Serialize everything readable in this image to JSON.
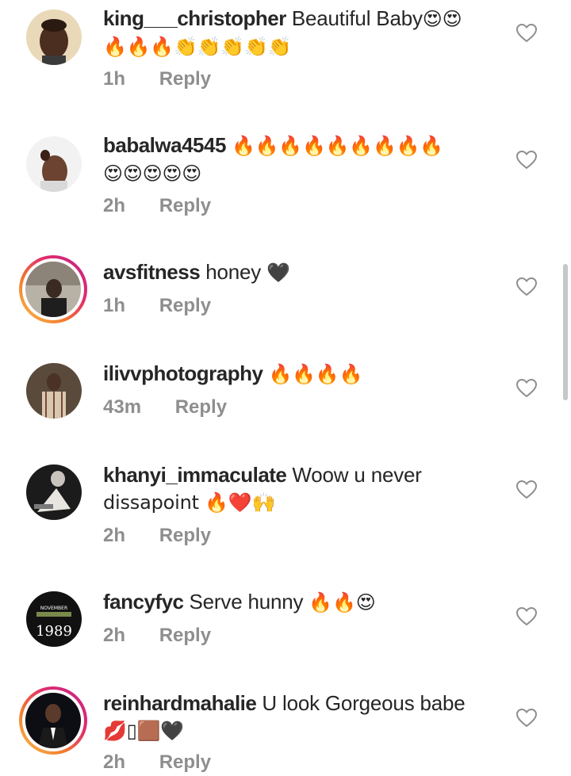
{
  "comments": [
    {
      "username": "king___christopher",
      "text": "Beautiful Baby",
      "emoji_after_text": "😍😍",
      "line2": "🔥🔥🔥👏👏👏👏👏",
      "time": "1h",
      "reply_label": "Reply"
    },
    {
      "username": "babalwa4545",
      "text": "",
      "emoji_after_text": "🔥🔥🔥🔥🔥🔥🔥🔥🔥",
      "line2": "😍😍😍😍😍",
      "time": "2h",
      "reply_label": "Reply"
    },
    {
      "username": "avsfitness",
      "text": "honey",
      "emoji_after_text": "🖤",
      "line2": "",
      "time": "1h",
      "reply_label": "Reply"
    },
    {
      "username": "ilivvphotography",
      "text": "",
      "emoji_after_text": "🔥🔥🔥🔥",
      "line2": "",
      "time": "43m",
      "reply_label": "Reply"
    },
    {
      "username": "khanyi_immaculate",
      "text": "Woow u never",
      "emoji_after_text": "",
      "line2": "dissapoint 🔥❤️🙌",
      "time": "2h",
      "reply_label": "Reply"
    },
    {
      "username": "fancyfyc",
      "text": "Serve hunny",
      "emoji_after_text": "🔥🔥😍",
      "line2": "",
      "time": "2h",
      "reply_label": "Reply"
    },
    {
      "username": "reinhardmahalie",
      "text": "U look Gorgeous babe",
      "emoji_after_text": "",
      "line2": "💋▯🟫🖤",
      "time": "2h",
      "reply_label": "Reply"
    }
  ],
  "avatar_fancyfyc": {
    "top_text": "NOVEMBER",
    "year": "1989"
  },
  "colors": {
    "text": "#262626",
    "meta": "#8e8e8e",
    "heart_outline": "#8e8e8e",
    "story_ring_start": "#f9c24e",
    "story_ring_end": "#c2248f"
  },
  "icons": {
    "like": "heart-outline-icon"
  }
}
